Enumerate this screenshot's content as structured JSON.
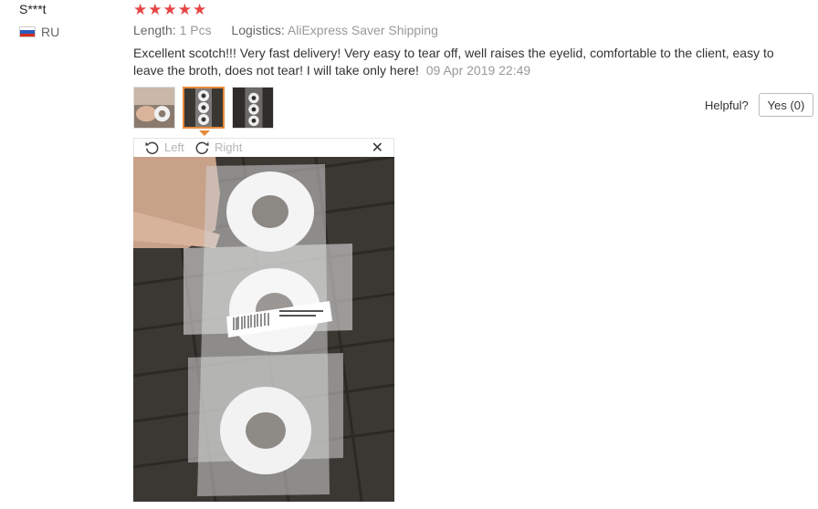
{
  "review": {
    "user_name": "S***t",
    "country_code": "RU",
    "stars": "★★★★★",
    "rating": 5,
    "length_label": "Length:",
    "length_value": "1 Pcs",
    "logistics_label": "Logistics:",
    "logistics_value": "AliExpress Saver Shipping",
    "text": "Excellent scotch!!! Very fast delivery! Very easy to tear off, well raises the eyelid, comfortable to the client, easy to leave the broth, does not tear! I will take only here!",
    "date": "09 Apr 2019 22:49"
  },
  "helpful": {
    "label": "Helpful?",
    "yes_button": "Yes (0)"
  },
  "viewer": {
    "rotate_left_label": "Left",
    "rotate_right_label": "Right",
    "close_glyph": "✕"
  },
  "icons": {
    "rotate_left": "rotate-left-icon",
    "rotate_right": "rotate-right-icon",
    "close": "close-icon",
    "flag": "russia-flag-icon"
  },
  "colors": {
    "star": "#e64545",
    "active_thumb_border": "#e88a3c",
    "muted_text": "#999999"
  }
}
